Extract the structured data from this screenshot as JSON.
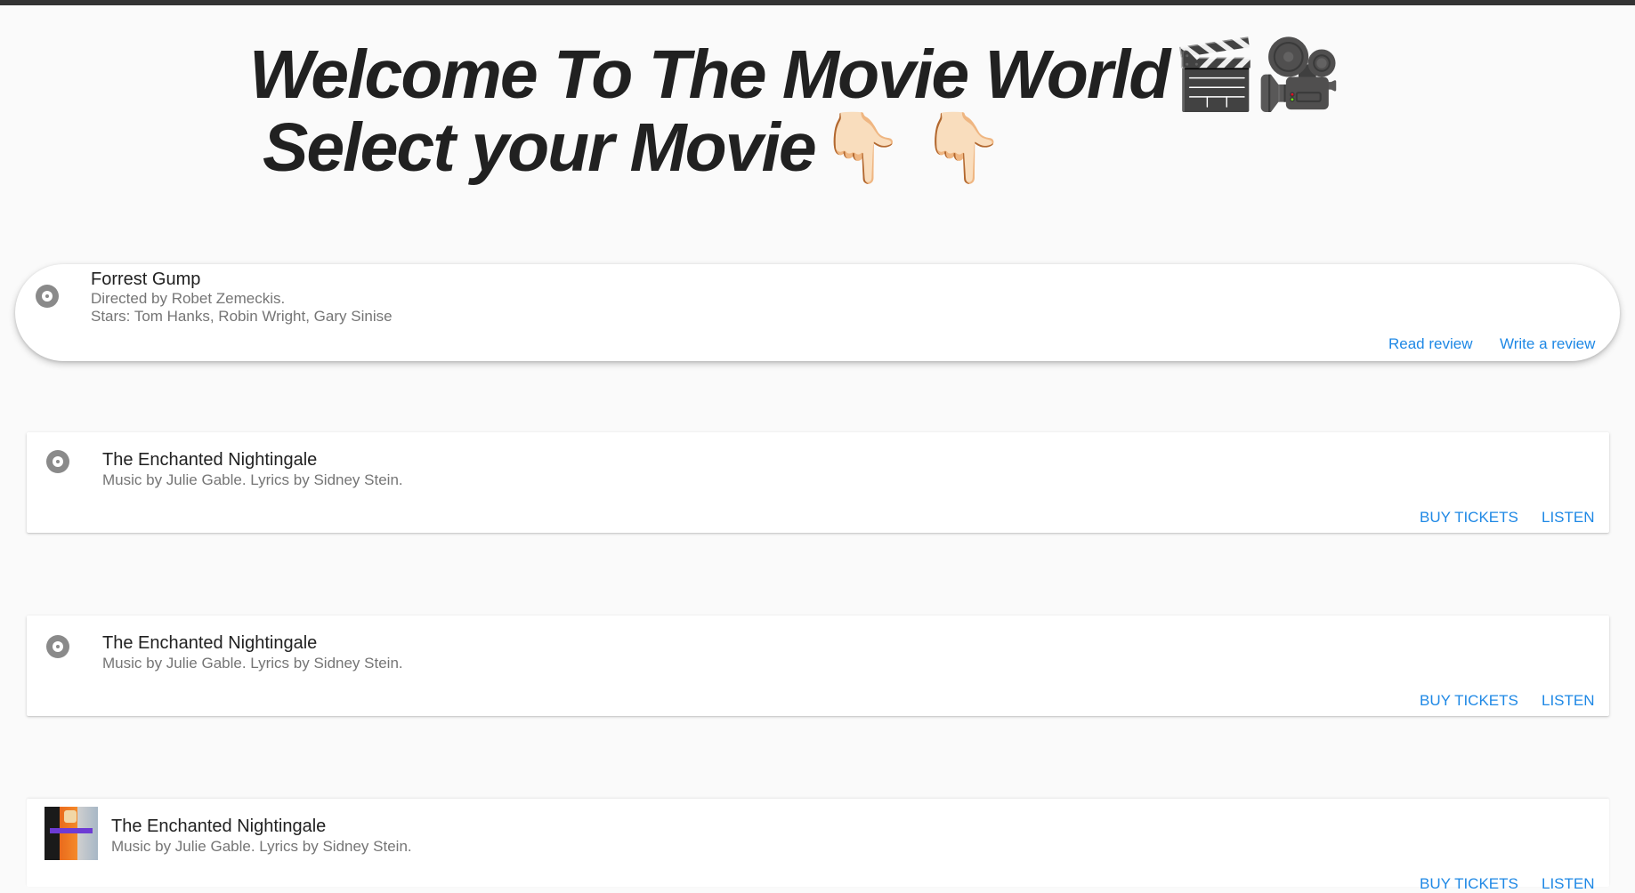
{
  "header": {
    "line1": "Welcome To The Movie World",
    "line1_emoji": "🎬🎥",
    "line2": "Select your Movie",
    "line2_emoji": "👇🏻 👇🏻"
  },
  "cards": [
    {
      "icon": "disc-icon",
      "title": "Forrest Gump",
      "subtitle1": "Directed by Robet Zemeckis.",
      "subtitle2": "Stars: Tom Hanks, Robin Wright, Gary Sinise",
      "action1": "Read review",
      "action2": "Write a review"
    },
    {
      "icon": "disc-icon",
      "title": "The Enchanted Nightingale",
      "subtitle1": "Music by Julie Gable. Lyrics by Sidney Stein.",
      "action1": "BUY TICKETS",
      "action2": "LISTEN"
    },
    {
      "icon": "disc-icon",
      "title": "The Enchanted Nightingale",
      "subtitle1": "Music by Julie Gable. Lyrics by Sidney Stein.",
      "action1": "BUY TICKETS",
      "action2": "LISTEN"
    },
    {
      "icon": "album-thumbnail",
      "title": "The Enchanted Nightingale",
      "subtitle1": "Music by Julie Gable. Lyrics by Sidney Stein.",
      "action1": "BUY TICKETS",
      "action2": "LISTEN"
    }
  ],
  "colors": {
    "background": "#fafafa",
    "top_bar": "#333333",
    "accent": "#1e88e5",
    "secondary_text": "#757575"
  }
}
